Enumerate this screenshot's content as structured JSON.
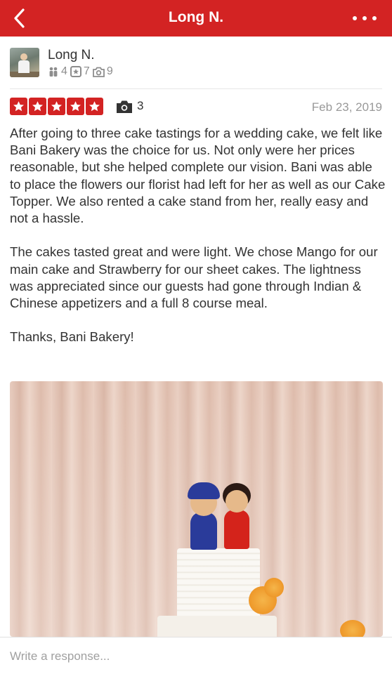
{
  "header": {
    "title": "Long N.",
    "back_icon": "chevron-left-icon",
    "more_icon": "more-horizontal-icon",
    "background": "#d32323"
  },
  "user": {
    "name": "Long N.",
    "friends_count": "4",
    "reviews_count": "7",
    "photos_count": "9"
  },
  "review": {
    "rating": 5,
    "photo_count": "3",
    "date": "Feb 23, 2019",
    "text": "After going to three cake tastings for a wedding cake, we felt like Bani Bakery was the choice for us. Not only were her prices reasonable, but she helped complete our vision. Bani was able to place the flowers our florist had left for her as well as our Cake Topper. We also rented a cake stand from her, really easy and not a hassle.\n\nThe cakes tasted great and were light. We chose Mango for our main cake and Strawberry for our sheet cakes. The lightness was appreciated since our guests had gone through Indian & Chinese appetizers and a full 8 course meal.\n\nThanks, Bani Bakery!"
  },
  "response": {
    "placeholder": "Write a response..."
  }
}
